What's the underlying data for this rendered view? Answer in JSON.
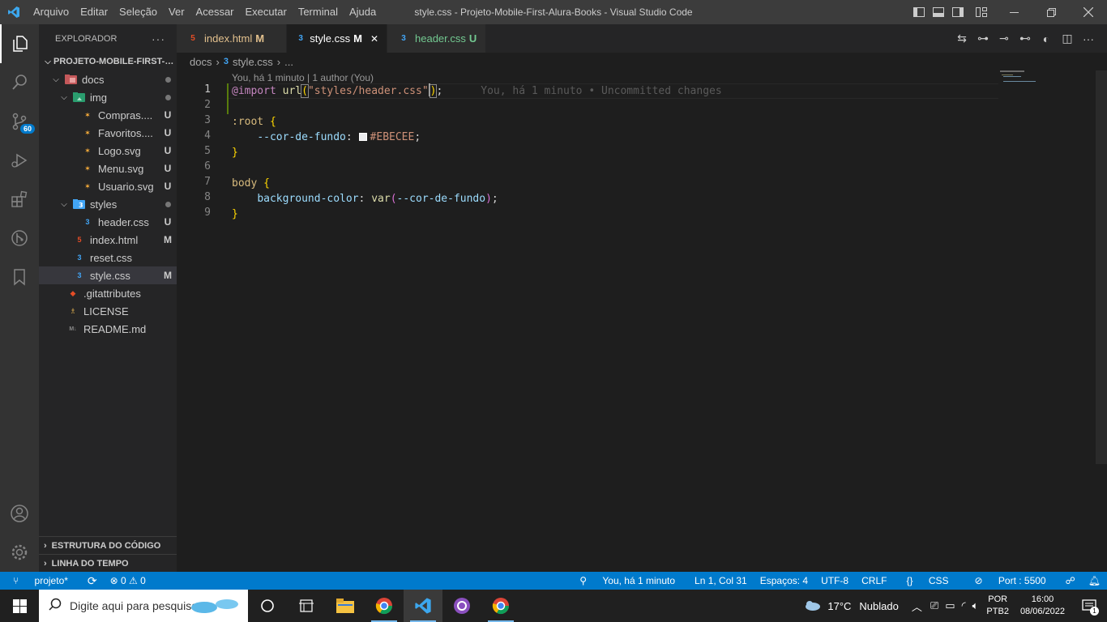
{
  "titlebar": {
    "menus": [
      "Arquivo",
      "Editar",
      "Seleção",
      "Ver",
      "Acessar",
      "Executar",
      "Terminal",
      "Ajuda"
    ],
    "window_title": "style.css - Projeto-Mobile-First-Alura-Books - Visual Studio Code",
    "accent": "#3c3c3c"
  },
  "activity_bar": {
    "items": [
      "files-icon",
      "search-icon",
      "source-control-icon",
      "run-debug-icon",
      "extensions-icon",
      "git-graph-icon",
      "bookmark-icon"
    ],
    "scm_badge": "60",
    "bottom_items": [
      "account-icon",
      "manage-gear-icon"
    ]
  },
  "sidebar": {
    "title": "EXPLORADOR",
    "more": "···",
    "project": "PROJETO-MOBILE-FIRST-A...",
    "tree": [
      {
        "label": "docs",
        "status": "",
        "kind": "folder"
      },
      {
        "label": "img",
        "status": "",
        "kind": "folder"
      },
      {
        "label": "Compras....",
        "status": "U",
        "kind": "svg"
      },
      {
        "label": "Favoritos....",
        "status": "U",
        "kind": "svg"
      },
      {
        "label": "Logo.svg",
        "status": "U",
        "kind": "svg"
      },
      {
        "label": "Menu.svg",
        "status": "U",
        "kind": "svg"
      },
      {
        "label": "Usuario.svg",
        "status": "U",
        "kind": "svg"
      },
      {
        "label": "styles",
        "status": "",
        "kind": "folder"
      },
      {
        "label": "header.css",
        "status": "U",
        "kind": "css"
      },
      {
        "label": "index.html",
        "status": "M",
        "kind": "html"
      },
      {
        "label": "reset.css",
        "status": "",
        "kind": "css"
      },
      {
        "label": "style.css",
        "status": "M",
        "kind": "css"
      },
      {
        "label": ".gitattributes",
        "status": "",
        "kind": "git"
      },
      {
        "label": "LICENSE",
        "status": "",
        "kind": "license"
      },
      {
        "label": "README.md",
        "status": "",
        "kind": "md"
      }
    ],
    "sections": [
      "ESTRUTURA DO CÓDIGO",
      "LINHA DO TEMPO"
    ]
  },
  "tabs": [
    {
      "label": "index.html",
      "status": "M",
      "kind": "html",
      "active": false
    },
    {
      "label": "style.css",
      "status": "M",
      "kind": "css",
      "active": true,
      "close": "✕"
    },
    {
      "label": "header.css",
      "status": "U",
      "kind": "css",
      "active": false
    }
  ],
  "breadcrumb": {
    "folder": "docs",
    "file": "style.css",
    "rest": "..."
  },
  "editor": {
    "blame": "You, há 1 minuto | 1 author (You)",
    "ghost_text": "You, há 1 minuto • Uncommitted changes",
    "line_numbers": [
      "1",
      "2",
      "3",
      "4",
      "5",
      "6",
      "7",
      "8",
      "9"
    ],
    "line1": {
      "at": "@import",
      "fn": "url",
      "open": "(",
      "str": "\"styles/header.css\"",
      "close": ")",
      "end": ";"
    },
    "line3": {
      "sel": ":root",
      "brace": "{"
    },
    "line4": {
      "prop": "--cor-de-fundo",
      "colon": ":",
      "value": "#EBECEE",
      "end": ";"
    },
    "line5": {
      "brace": "}"
    },
    "line7": {
      "sel": "body",
      "brace": "{"
    },
    "line8": {
      "prop": "background-color",
      "colon": ":",
      "fn": "var",
      "open": "(",
      "arg": "--cor-de-fundo",
      "close": ")",
      "end": ";"
    },
    "line9": {
      "brace": "}"
    },
    "swatch_color": "#EBECEE"
  },
  "statusbar": {
    "branch": "projeto*",
    "sync": "⟳",
    "problems": "⊗ 0 ⚠ 0",
    "blame": "You, há 1 minuto",
    "position": "Ln 1, Col 31",
    "spaces": "Espaços: 4",
    "encoding": "UTF-8",
    "eol": "CRLF",
    "language": "CSS",
    "port": "Port : 5500",
    "accent": "#007acc"
  },
  "taskbar": {
    "search_placeholder": "Digite aqui para pesquisar",
    "weather_temp": "17°C",
    "weather_text": "Nublado",
    "lang_top": "POR",
    "lang_bottom": "PTB2",
    "time": "16:00",
    "date": "08/06/2022",
    "notif_count": "1"
  }
}
